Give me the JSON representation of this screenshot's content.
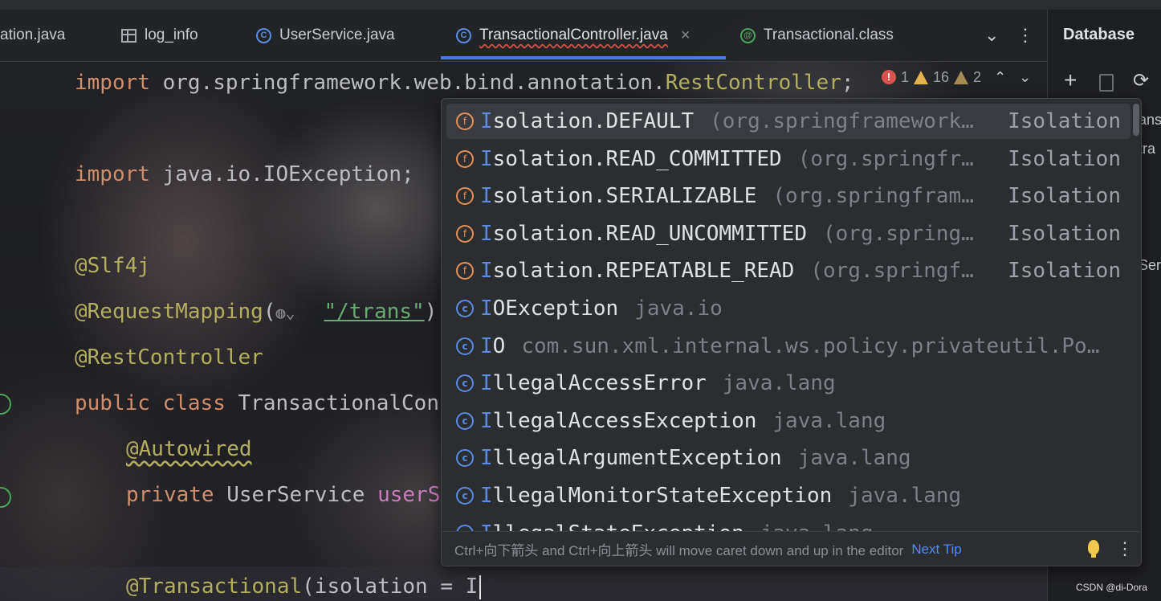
{
  "tabs": [
    {
      "label": "ation.java",
      "icon": "none"
    },
    {
      "label": "log_info",
      "icon": "table-icon"
    },
    {
      "label": "UserService.java",
      "icon": "class-icon"
    },
    {
      "label": "TransactionalController.java",
      "icon": "class-icon",
      "active": true
    },
    {
      "label": "Transactional.class",
      "icon": "annotation-icon"
    }
  ],
  "right_panel": {
    "title": "Database",
    "fragments": [
      "ans",
      "tra",
      "Ser"
    ]
  },
  "inspections": {
    "errors": "1",
    "warnings": "16",
    "weak_warnings": "2"
  },
  "code": {
    "line1": {
      "kw": "import",
      "pkg": " org.springframework.web.bind.annotation.",
      "cls": "RestController",
      "end": ";"
    },
    "line2": {
      "kw": "import",
      "rest": " java.io.IOException;"
    },
    "line3": "@Slf4j",
    "line4": {
      "ann": "@RequestMapping",
      "open": "(",
      "str": "\"/trans\"",
      "close": ")"
    },
    "line5": "@RestController",
    "line6": {
      "kw1": "public",
      "kw2": "class",
      "name": " TransactionalCon"
    },
    "line7": "@Autowired",
    "line8": {
      "kw": "private",
      "type": " UserService ",
      "field": "userS"
    },
    "line9": {
      "ann": "@Transactional",
      "rest": "(isolation = ",
      "typed": "I"
    }
  },
  "completion": {
    "items": [
      {
        "icon": "f",
        "match": "I",
        "name": "solation.DEFAULT",
        "pkg": "(org.springframework…",
        "type": "Isolation",
        "selected": true
      },
      {
        "icon": "f",
        "match": "I",
        "name": "solation.READ_COMMITTED",
        "pkg": "(org.springfr…",
        "type": "Isolation"
      },
      {
        "icon": "f",
        "match": "I",
        "name": "solation.SERIALIZABLE",
        "pkg": "(org.springfram…",
        "type": "Isolation"
      },
      {
        "icon": "f",
        "match": "I",
        "name": "solation.READ_UNCOMMITTED",
        "pkg": "(org.spring…",
        "type": "Isolation"
      },
      {
        "icon": "f",
        "match": "I",
        "name": "solation.REPEATABLE_READ",
        "pkg": "(org.springf…",
        "type": "Isolation"
      },
      {
        "icon": "c",
        "match": "I",
        "name": "OException",
        "pkg": "java.io",
        "type": ""
      },
      {
        "icon": "c",
        "match": "I",
        "name": "O",
        "pkg": "com.sun.xml.internal.ws.policy.privateutil.Po…",
        "type": ""
      },
      {
        "icon": "c",
        "match": "I",
        "name": "llegalAccessError",
        "pkg": "java.lang",
        "type": ""
      },
      {
        "icon": "c",
        "match": "I",
        "name": "llegalAccessException",
        "pkg": "java.lang",
        "type": ""
      },
      {
        "icon": "c",
        "match": "I",
        "name": "llegalArgumentException",
        "pkg": "java.lang",
        "type": ""
      },
      {
        "icon": "c",
        "match": "I",
        "name": "llegalMonitorStateException",
        "pkg": "java.lang",
        "type": ""
      },
      {
        "icon": "c",
        "match": "I",
        "name": "llegalStateException",
        "pkg": "java.lang",
        "type": ""
      }
    ],
    "footer_hint": "Ctrl+向下箭头 and Ctrl+向上箭头 will move caret down and up in the editor",
    "footer_link": "Next Tip"
  },
  "watermark": "CSDN @di-Dora"
}
